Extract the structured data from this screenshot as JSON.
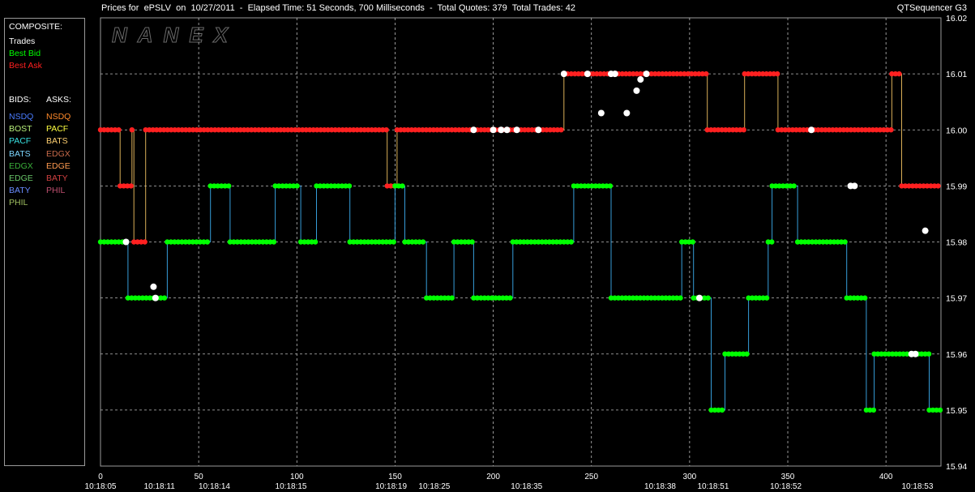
{
  "header": {
    "title": "Prices for  ePSLV  on  10/27/2011  -  Elapsed Time: 51 Seconds, 700 Milliseconds  -  Total Quotes: 379  Total Trades: 42",
    "app_name": "QTSequencer G3"
  },
  "watermark": "NANEX",
  "legend": {
    "composite_heading": "COMPOSITE:",
    "composite": [
      {
        "label": "Trades",
        "color": "#ffffff"
      },
      {
        "label": "Best Bid",
        "color": "#00ff00"
      },
      {
        "label": "Best Ask",
        "color": "#ff2020"
      }
    ],
    "bids_heading": "BIDS:",
    "asks_heading": "ASKS:",
    "bids": [
      {
        "label": "NSDQ",
        "color": "#4a7cff"
      },
      {
        "label": "BOST",
        "color": "#b8f07a"
      },
      {
        "label": "PACF",
        "color": "#38e0e0"
      },
      {
        "label": "BATS",
        "color": "#7cd6ff"
      },
      {
        "label": "EDGX",
        "color": "#3ab03a"
      },
      {
        "label": "EDGE",
        "color": "#6ac86a"
      },
      {
        "label": "BATY",
        "color": "#6a8cff"
      },
      {
        "label": "PHIL",
        "color": "#a0c060"
      }
    ],
    "asks": [
      {
        "label": "NSDQ",
        "color": "#ff8a2a"
      },
      {
        "label": "PACF",
        "color": "#ffff40"
      },
      {
        "label": "BATS",
        "color": "#ffd070"
      },
      {
        "label": "EDGX",
        "color": "#c86a4a"
      },
      {
        "label": "EDGE",
        "color": "#ff9a50"
      },
      {
        "label": "BATY",
        "color": "#d04040"
      },
      {
        "label": "PHIL",
        "color": "#c05070"
      }
    ]
  },
  "chart_data": {
    "type": "line",
    "ylim": [
      15.94,
      16.02
    ],
    "xlim": [
      0,
      428
    ],
    "y_ticks": [
      "16.02",
      "16.01",
      "16.00",
      "15.99",
      "15.98",
      "15.97",
      "15.96",
      "15.95",
      "15.94"
    ],
    "x_ticks": [
      0,
      50,
      100,
      150,
      200,
      250,
      300,
      350,
      400
    ],
    "time_labels": [
      {
        "x": 0,
        "label": "10:18:05"
      },
      {
        "x": 30,
        "label": "10:18:11"
      },
      {
        "x": 58,
        "label": "10:18:14"
      },
      {
        "x": 97,
        "label": "10:18:15"
      },
      {
        "x": 148,
        "label": "10:18:19"
      },
      {
        "x": 170,
        "label": "10:18:25"
      },
      {
        "x": 217,
        "label": "10:18:35"
      },
      {
        "x": 285,
        "label": "10:18:38"
      },
      {
        "x": 312,
        "label": "10:18:51"
      },
      {
        "x": 349,
        "label": "10:18:52"
      },
      {
        "x": 416,
        "label": "10:18:53"
      }
    ],
    "series": [
      {
        "name": "Best Ask",
        "color": "#ff2020",
        "points": [
          [
            0,
            16.0
          ],
          [
            10,
            16.0
          ],
          [
            10,
            15.99
          ],
          [
            16,
            15.99
          ],
          [
            16,
            16.0
          ],
          [
            17,
            16.0
          ],
          [
            17,
            15.98
          ],
          [
            23,
            15.98
          ],
          [
            23,
            16.0
          ],
          [
            146,
            16.0
          ],
          [
            146,
            15.99
          ],
          [
            151,
            15.99
          ],
          [
            151,
            16.0
          ],
          [
            236,
            16.0
          ],
          [
            236,
            16.01
          ],
          [
            309,
            16.01
          ],
          [
            309,
            16.0
          ],
          [
            328,
            16.0
          ],
          [
            328,
            16.01
          ],
          [
            345,
            16.01
          ],
          [
            345,
            16.0
          ],
          [
            403,
            16.0
          ],
          [
            403,
            16.01
          ],
          [
            408,
            16.01
          ],
          [
            408,
            15.99
          ],
          [
            428,
            15.99
          ]
        ]
      },
      {
        "name": "Best Bid",
        "color": "#00ff00",
        "points": [
          [
            0,
            15.98
          ],
          [
            14,
            15.98
          ],
          [
            14,
            15.97
          ],
          [
            34,
            15.97
          ],
          [
            34,
            15.98
          ],
          [
            56,
            15.98
          ],
          [
            56,
            15.99
          ],
          [
            66,
            15.99
          ],
          [
            66,
            15.98
          ],
          [
            89,
            15.98
          ],
          [
            89,
            15.99
          ],
          [
            102,
            15.99
          ],
          [
            102,
            15.98
          ],
          [
            110,
            15.98
          ],
          [
            110,
            15.99
          ],
          [
            127,
            15.99
          ],
          [
            127,
            15.98
          ],
          [
            150,
            15.98
          ],
          [
            150,
            15.99
          ],
          [
            155,
            15.99
          ],
          [
            155,
            15.98
          ],
          [
            166,
            15.98
          ],
          [
            166,
            15.97
          ],
          [
            180,
            15.97
          ],
          [
            180,
            15.98
          ],
          [
            190,
            15.98
          ],
          [
            190,
            15.97
          ],
          [
            210,
            15.97
          ],
          [
            210,
            15.98
          ],
          [
            241,
            15.98
          ],
          [
            241,
            15.99
          ],
          [
            260,
            15.99
          ],
          [
            260,
            15.97
          ],
          [
            296,
            15.97
          ],
          [
            296,
            15.98
          ],
          [
            302,
            15.98
          ],
          [
            302,
            15.97
          ],
          [
            311,
            15.97
          ],
          [
            311,
            15.95
          ],
          [
            318,
            15.95
          ],
          [
            318,
            15.96
          ],
          [
            330,
            15.96
          ],
          [
            330,
            15.97
          ],
          [
            340,
            15.97
          ],
          [
            340,
            15.98
          ],
          [
            342,
            15.98
          ],
          [
            342,
            15.99
          ],
          [
            355,
            15.99
          ],
          [
            355,
            15.98
          ],
          [
            380,
            15.98
          ],
          [
            380,
            15.97
          ],
          [
            390,
            15.97
          ],
          [
            390,
            15.95
          ],
          [
            394,
            15.95
          ],
          [
            394,
            15.96
          ],
          [
            422,
            15.96
          ],
          [
            422,
            15.95
          ],
          [
            428,
            15.95
          ]
        ]
      },
      {
        "name": "Trades",
        "color": "#ffffff",
        "points": [
          [
            13,
            15.98
          ],
          [
            27,
            15.972
          ],
          [
            28,
            15.97
          ],
          [
            190,
            16.0
          ],
          [
            200,
            16.0
          ],
          [
            204,
            16.0
          ],
          [
            207,
            16.0
          ],
          [
            212,
            16.0
          ],
          [
            223,
            16.0
          ],
          [
            236,
            16.01
          ],
          [
            248,
            16.01
          ],
          [
            255,
            16.003
          ],
          [
            260,
            16.01
          ],
          [
            262,
            16.01
          ],
          [
            273,
            16.007
          ],
          [
            275,
            16.009
          ],
          [
            278,
            16.01
          ],
          [
            268,
            16.003
          ],
          [
            305,
            15.97
          ],
          [
            362,
            16.0
          ],
          [
            382,
            15.99
          ],
          [
            384,
            15.99
          ],
          [
            413,
            15.96
          ],
          [
            415,
            15.96
          ],
          [
            420,
            15.982
          ]
        ]
      }
    ]
  }
}
